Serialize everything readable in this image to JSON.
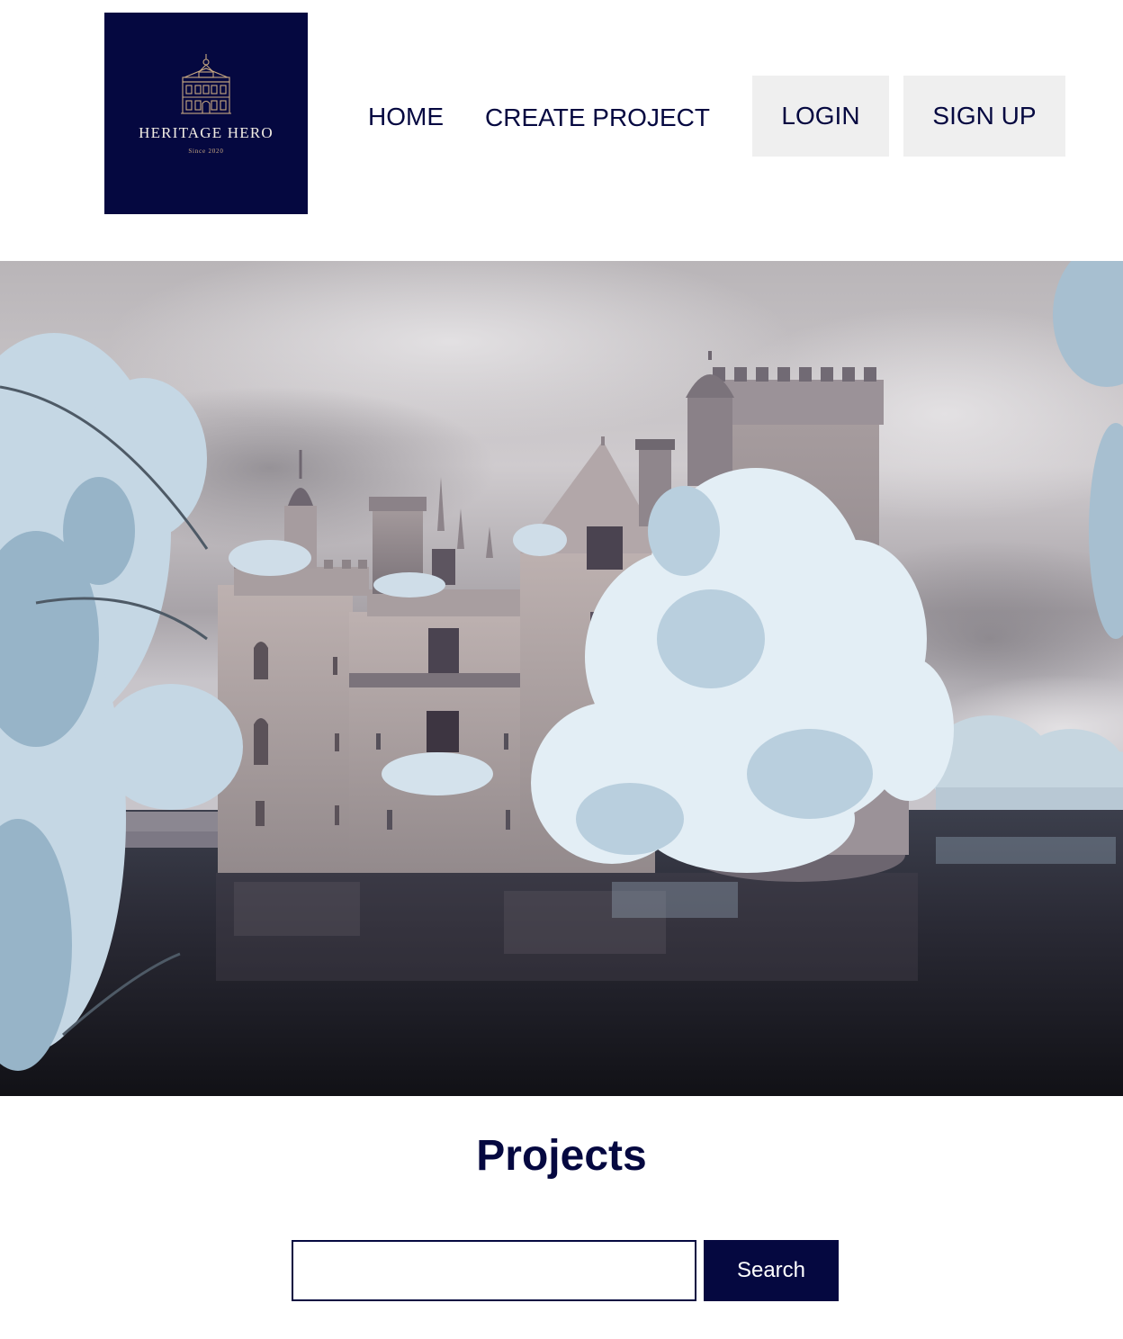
{
  "header": {
    "logo": {
      "title": "HERITAGE HERO",
      "subtitle": "Since 2020",
      "background": "#050840",
      "accent": "#c9a982"
    },
    "nav": {
      "home": "HOME",
      "create_project": "CREATE PROJECT"
    },
    "auth": {
      "login": "LOGIN",
      "signup": "SIGN UP"
    }
  },
  "hero": {
    "subject": "castle-by-lake-photo"
  },
  "projects": {
    "title": "Projects",
    "search_value": "",
    "search_placeholder": "",
    "search_button": "Search"
  },
  "colors": {
    "navy": "#050840",
    "button_gray": "#efefef",
    "white": "#ffffff"
  }
}
